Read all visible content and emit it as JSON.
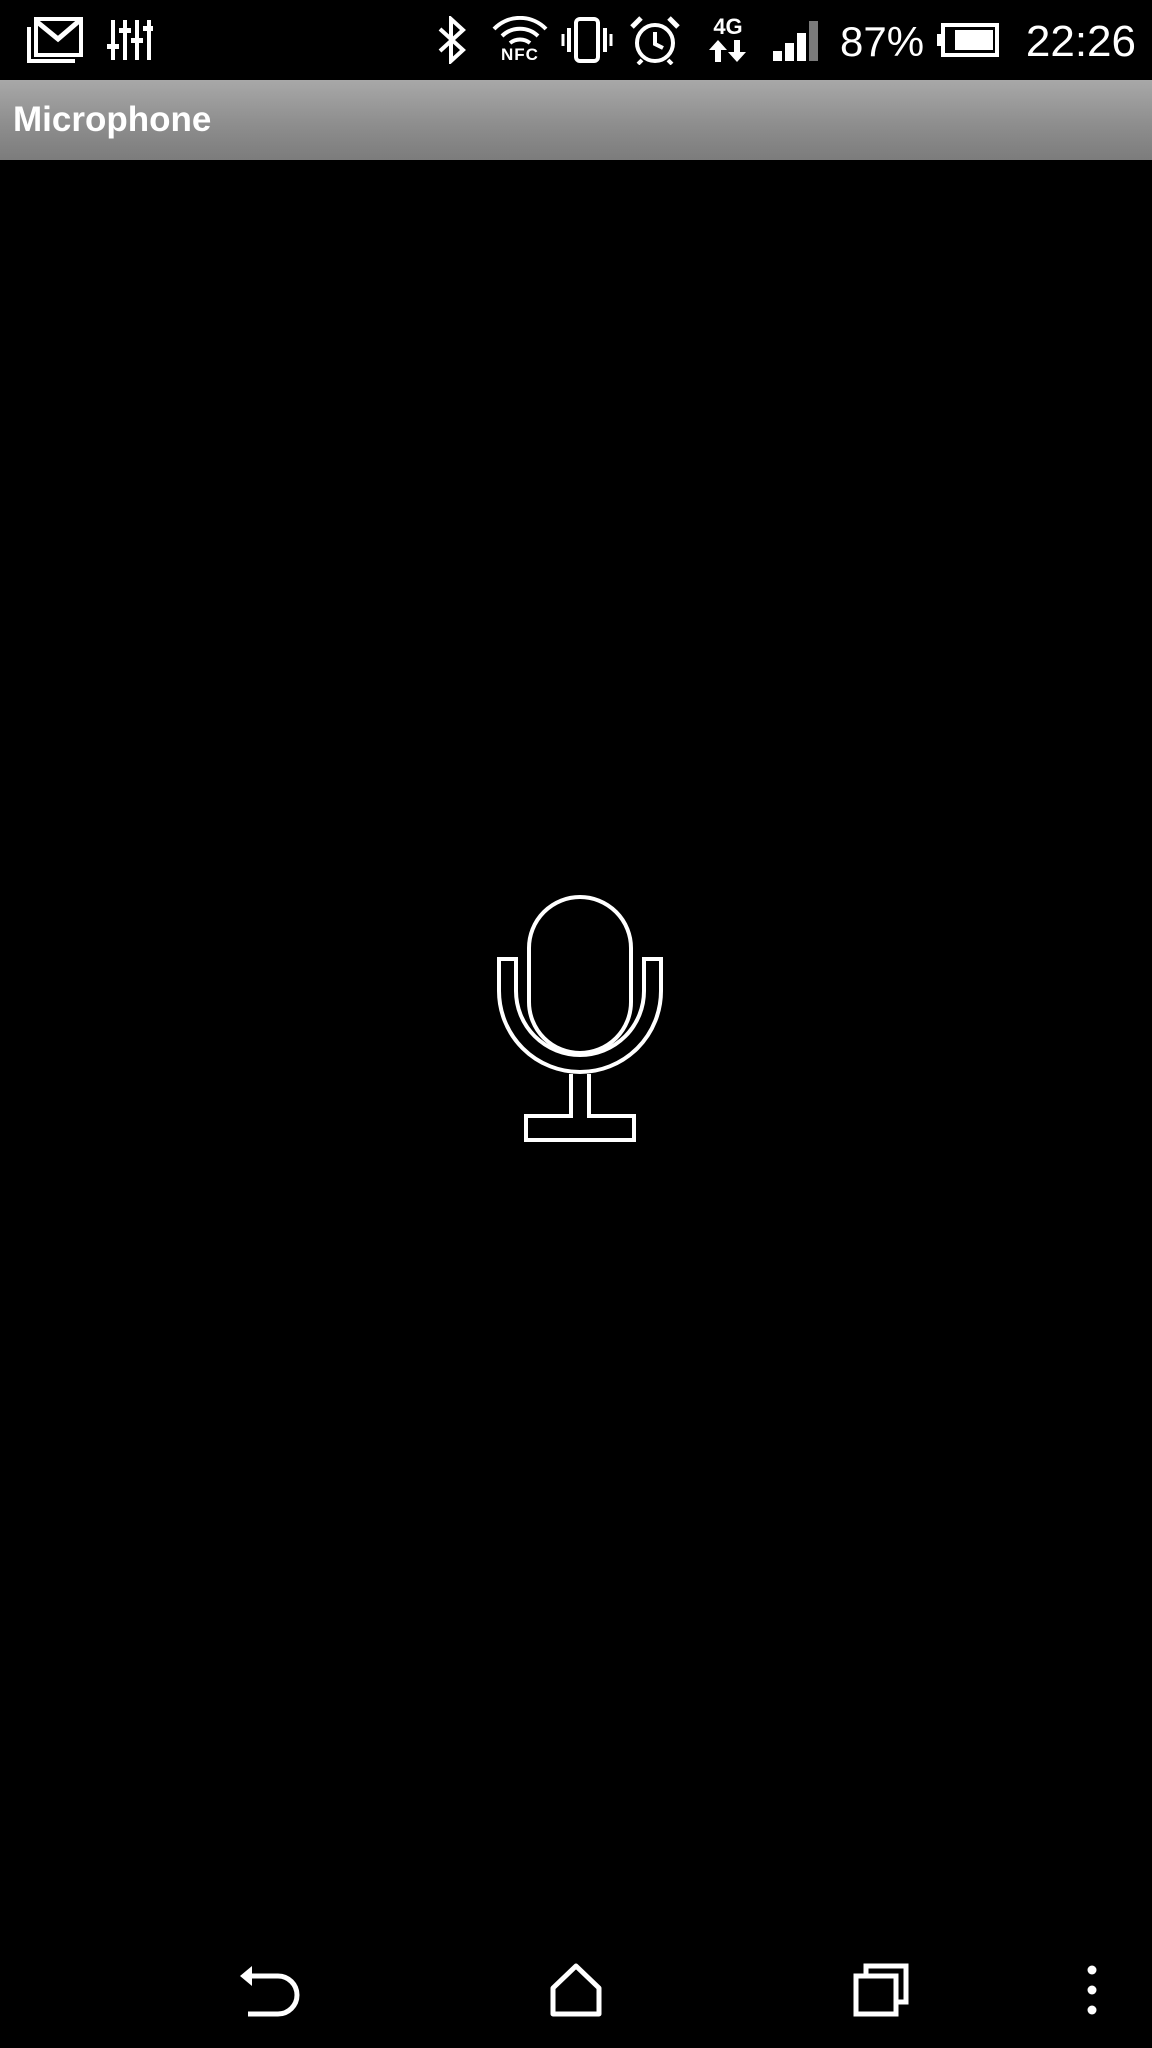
{
  "status_bar": {
    "left_icons": [
      "gmail-icon",
      "equalizer-icon"
    ],
    "right_icons": [
      "bluetooth-icon",
      "nfc-wifi-icon",
      "vibrate-icon",
      "alarm-icon",
      "network-4g-icon",
      "signal-icon",
      "battery-icon"
    ],
    "network_label": "4G",
    "nfc_label": "NFC",
    "battery_percent": "87%",
    "battery_level": 0.87,
    "time": "22:26"
  },
  "action_bar": {
    "title": "Microphone"
  },
  "content": {
    "mic_icon": "microphone-icon"
  },
  "nav_bar": {
    "buttons": [
      "back-icon",
      "home-icon",
      "recent-apps-icon",
      "overflow-menu-icon"
    ]
  },
  "colors": {
    "background": "#000000",
    "action_bar": "#8e8e8e",
    "foreground": "#ffffff"
  }
}
